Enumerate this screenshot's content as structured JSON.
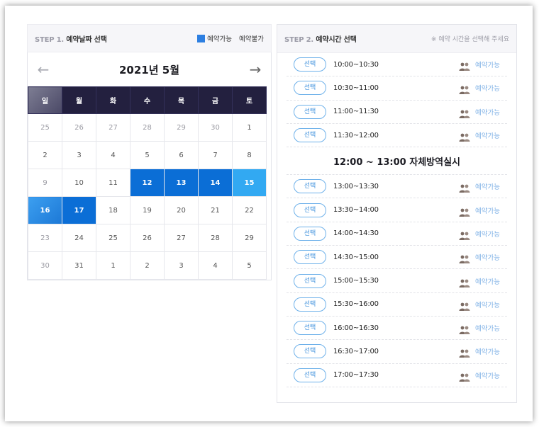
{
  "calendar": {
    "step_num": "STEP 1.",
    "step_title": "예약날짜 선택",
    "legend_available": "예약가능",
    "legend_unavailable": "예약불가",
    "month_title": "2021년 5월",
    "weekdays": [
      "일",
      "월",
      "화",
      "수",
      "목",
      "금",
      "토"
    ],
    "weeks": [
      [
        "25",
        "26",
        "27",
        "28",
        "29",
        "30",
        "1"
      ],
      [
        "2",
        "3",
        "4",
        "5",
        "6",
        "7",
        "8"
      ],
      [
        "9",
        "10",
        "11",
        "12",
        "13",
        "14",
        "15"
      ],
      [
        "16",
        "17",
        "18",
        "19",
        "20",
        "21",
        "22"
      ],
      [
        "23",
        "24",
        "25",
        "26",
        "27",
        "28",
        "29"
      ],
      [
        "30",
        "31",
        "1",
        "2",
        "3",
        "4",
        "5"
      ]
    ],
    "available_color": "#0b6ed6"
  },
  "times": {
    "step_num": "STEP 2.",
    "step_title": "예약시간 선택",
    "hint": "※ 예약 시간을 선택해 주세요",
    "select_label": "선택",
    "status_label": "예약가능",
    "break_text": "12:00 ~ 13:00 자체방역실시",
    "slots_before": [
      "10:00~10:30",
      "10:30~11:00",
      "11:00~11:30",
      "11:30~12:00"
    ],
    "slots_after": [
      "13:00~13:30",
      "13:30~14:00",
      "14:00~14:30",
      "14:30~15:00",
      "15:00~15:30",
      "15:30~16:00",
      "16:00~16:30",
      "16:30~17:00",
      "17:00~17:30"
    ]
  }
}
